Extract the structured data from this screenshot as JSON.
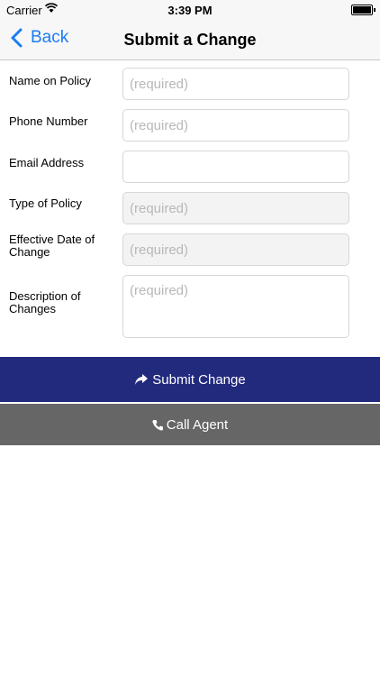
{
  "status": {
    "carrier": "Carrier",
    "time": "3:39 PM"
  },
  "nav": {
    "back_label": "Back",
    "title": "Submit a Change"
  },
  "form": {
    "fields": [
      {
        "label": "Name on Policy",
        "placeholder": "(required)"
      },
      {
        "label": "Phone Number",
        "placeholder": "(required)"
      },
      {
        "label": "Email Address",
        "placeholder": ""
      },
      {
        "label": "Type of Policy",
        "placeholder": "(required)"
      },
      {
        "label": "Effective Date of Change",
        "placeholder": "(required)"
      },
      {
        "label": "Description of Changes",
        "placeholder": "(required)"
      }
    ]
  },
  "actions": {
    "submit_label": "Submit Change",
    "call_label": "Call Agent"
  },
  "colors": {
    "accent": "#1a7cf5",
    "submit_bg": "#222a7e",
    "call_bg": "#666666"
  }
}
